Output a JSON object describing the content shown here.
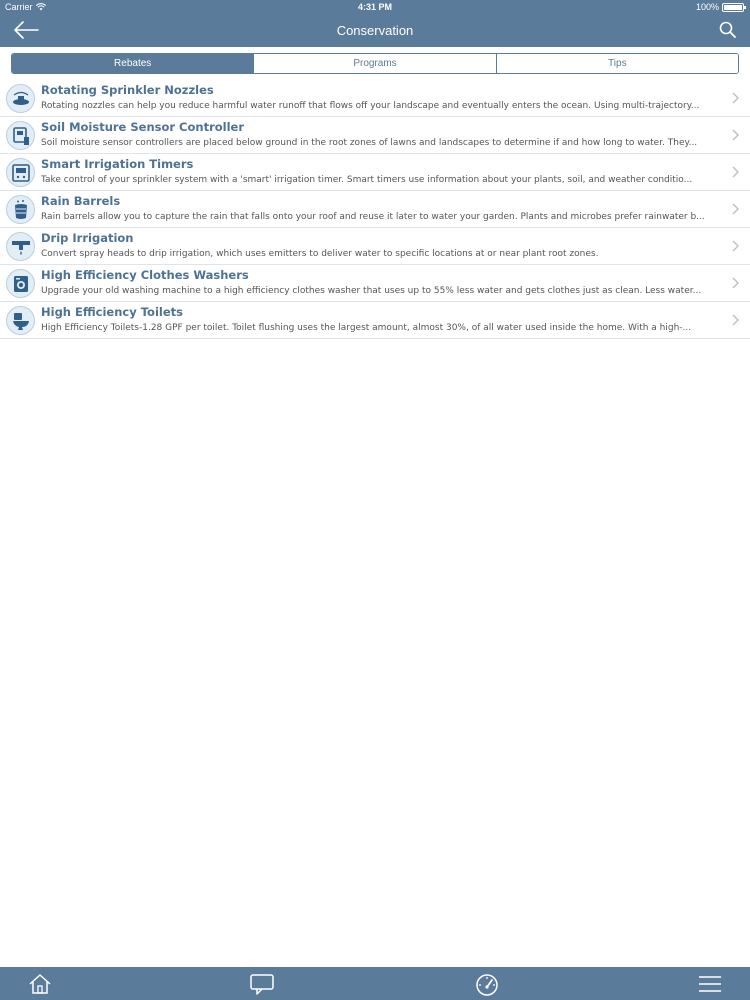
{
  "status": {
    "carrier": "Carrier",
    "time": "4:31 PM",
    "battery": "100%"
  },
  "nav": {
    "title": "Conservation",
    "back_icon": "back-arrow-icon",
    "search_icon": "search-icon"
  },
  "segments": [
    {
      "label": "Rebates",
      "active": true
    },
    {
      "label": "Programs",
      "active": false
    },
    {
      "label": "Tips",
      "active": false
    }
  ],
  "items": [
    {
      "name": "Rotating Sprinkler Nozzles",
      "desc": "Rotating nozzles can help you reduce harmful water runoff that flows off your landscape and eventually enters the ocean. Using multi-trajectory...",
      "icon": "sprinkler-nozzle-icon"
    },
    {
      "name": "Soil Moisture Sensor Controller",
      "desc": "Soil moisture sensor controllers are placed below ground in the root zones of lawns and landscapes to determine if and how long to water. They...",
      "icon": "soil-sensor-icon"
    },
    {
      "name": "Smart Irrigation Timers",
      "desc": "Take control of your sprinkler system with a 'smart' irrigation timer. Smart timers use information about your plants, soil, and weather conditio...",
      "icon": "irrigation-timer-icon"
    },
    {
      "name": "Rain Barrels",
      "desc": "Rain barrels allow you to capture the rain that falls onto your roof and reuse it later to water your garden. Plants and microbes prefer rainwater b...",
      "icon": "rain-barrel-icon"
    },
    {
      "name": "Drip Irrigation",
      "desc": "Convert spray heads to drip irrigation, which uses emitters to deliver water to specific locations at or near plant root zones.",
      "icon": "drip-irrigation-icon"
    },
    {
      "name": "High Efficiency Clothes Washers",
      "desc": "Upgrade your old washing machine to a high efficiency clothes washer that uses up to 55% less water and gets clothes just as clean. Less water...",
      "icon": "washing-machine-icon"
    },
    {
      "name": "High Efficiency Toilets",
      "desc": "High Efficiency Toilets-1.28 GPF per toilet. Toilet flushing uses the largest amount, almost 30%, of all water used inside the home. With a high-...",
      "icon": "toilet-icon"
    }
  ],
  "tabbar": [
    {
      "icon": "home-icon"
    },
    {
      "icon": "chat-bubble-icon"
    },
    {
      "icon": "speedometer-icon"
    },
    {
      "icon": "menu-icon"
    }
  ],
  "colors": {
    "primary": "#5a7b9a",
    "title_text": "#4d7294"
  }
}
